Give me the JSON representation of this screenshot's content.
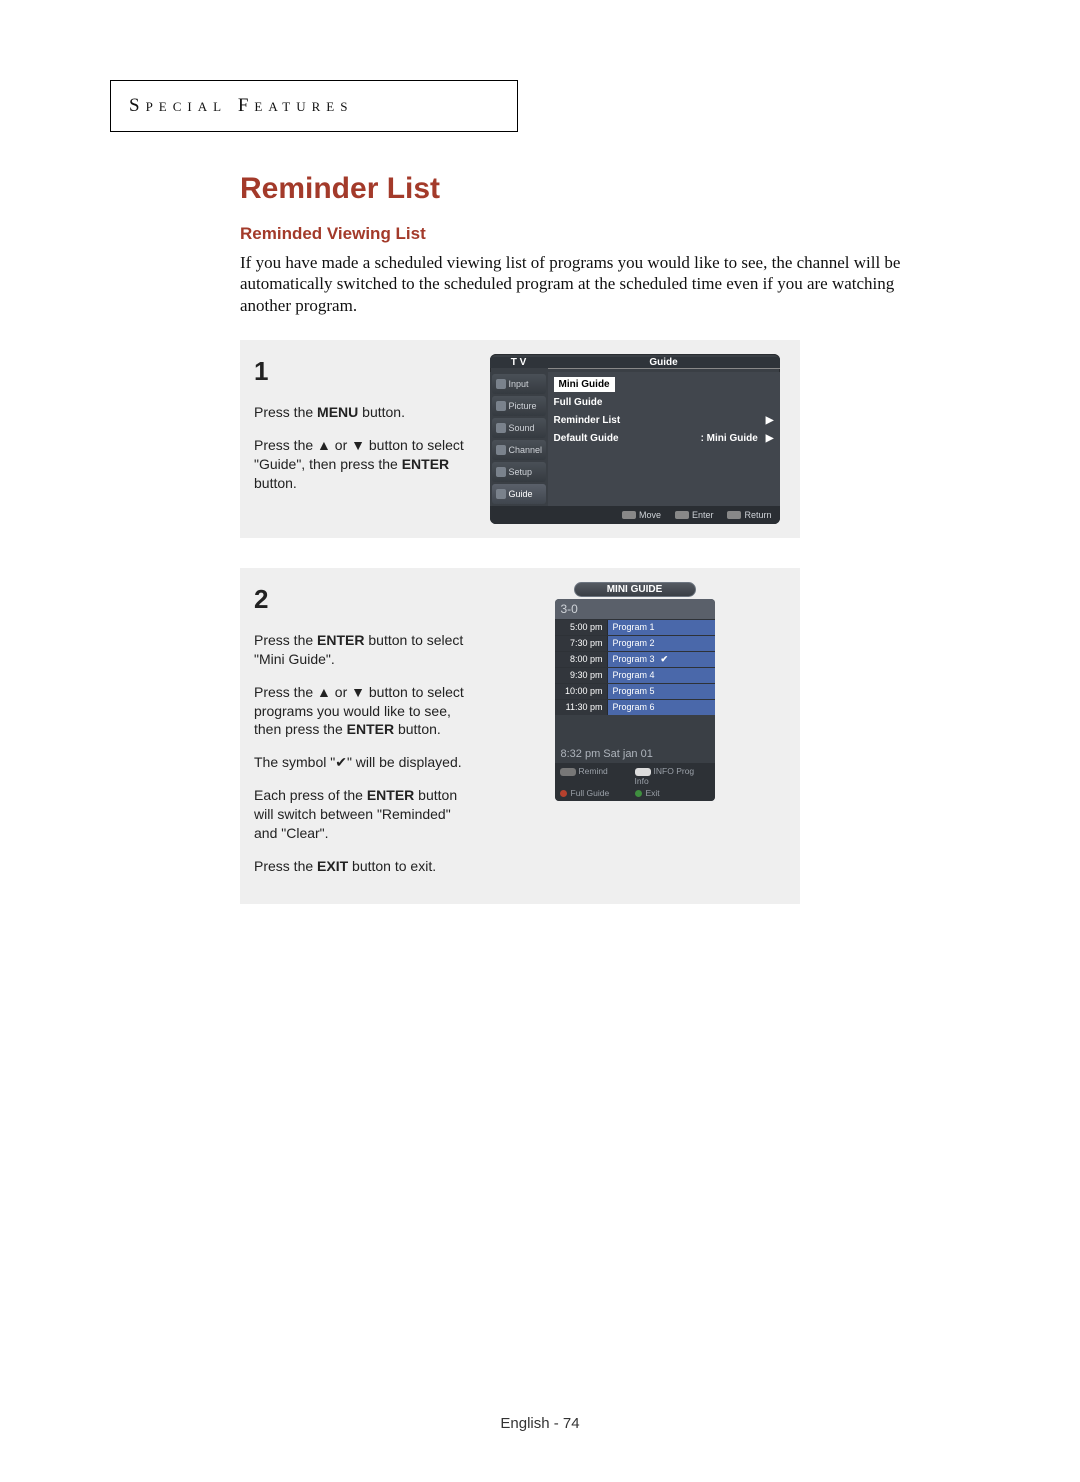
{
  "section_header": "Special Features",
  "title": "Reminder List",
  "subtitle": "Reminded Viewing List",
  "intro": "If you have made a scheduled viewing list of programs you would like to see, the channel will be automatically switched to the scheduled program at the scheduled time even if you are watching another program.",
  "steps": {
    "one": {
      "num": "1",
      "p1a": "Press the ",
      "p1b": "MENU",
      "p1c": " button.",
      "p2a": "Press the ",
      "p2b": " or ",
      "p2c": " button to select \"Guide\", then press the ",
      "p2d": "ENTER",
      "p2e": " button."
    },
    "two": {
      "num": "2",
      "p1a": "Press the ",
      "p1b": "ENTER",
      "p1c": " button to select \"Mini  Guide\".",
      "p2a": "Press the ",
      "p2b": " or ",
      "p2c": " button to select programs you would like to see, then press the ",
      "p2d": "ENTER",
      "p2e": " button.",
      "p3": "The symbol \"✔\" will be displayed.",
      "p4a": "Each press of the ",
      "p4b": "ENTER",
      "p4c": " button will switch between \"Reminded\" and \"Clear\".",
      "p5a": "Press the ",
      "p5b": "EXIT",
      "p5c": " button to exit."
    }
  },
  "osd": {
    "header_left": "T V",
    "header_right": "Guide",
    "side_items": [
      "Input",
      "Picture",
      "Sound",
      "Channel",
      "Setup",
      "Guide"
    ],
    "side_selected_index": 5,
    "main_rows": [
      {
        "label": "Mini Guide",
        "boxed": true
      },
      {
        "label": "Full Guide"
      },
      {
        "label": "Reminder List",
        "arrow": "▶"
      },
      {
        "label": "Default Guide",
        "value": ":   Mini Guide",
        "arrow": "▶"
      }
    ],
    "footer": [
      "Move",
      "Enter",
      "Return"
    ]
  },
  "mini_guide": {
    "title": "MINI GUIDE",
    "channel": "3-0",
    "rows": [
      {
        "time": "5:00 pm",
        "prog": "Program 1"
      },
      {
        "time": "7:30 pm",
        "prog": "Program 2"
      },
      {
        "time": "8:00 pm",
        "prog": "Program 3",
        "checked": true
      },
      {
        "time": "9:30 pm",
        "prog": "Program 4"
      },
      {
        "time": "10:00 pm",
        "prog": "Program 5"
      },
      {
        "time": "11:30 pm",
        "prog": "Program 6"
      }
    ],
    "status": "8:32 pm Sat jan 01",
    "footer": {
      "remind": "Remind",
      "prog_info": "Prog Info",
      "full_guide": "Full Guide",
      "exit": "Exit",
      "info_btn": "INFO"
    }
  },
  "page_footer": "English - 74"
}
